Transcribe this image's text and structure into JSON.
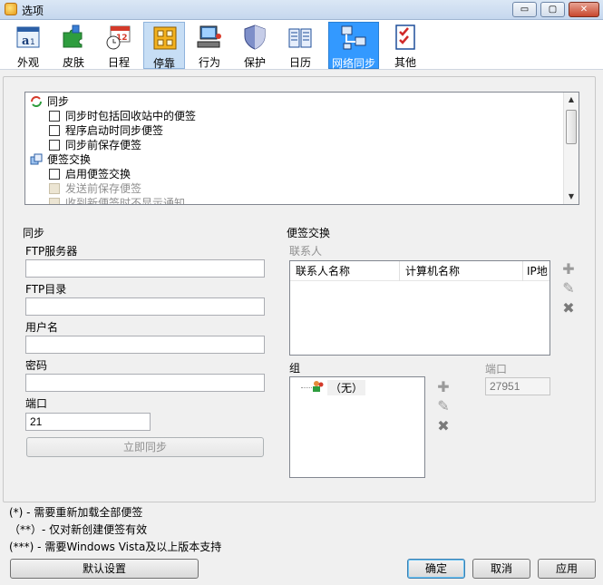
{
  "window": {
    "title": "选项",
    "controls": {
      "minimize": "▭",
      "maximize": "▢",
      "close": "✕"
    }
  },
  "toolbar": {
    "items": [
      {
        "label": "外观",
        "icon": "appearance-icon"
      },
      {
        "label": "皮肤",
        "icon": "skin-puzzle-icon"
      },
      {
        "label": "日程",
        "icon": "schedule-clock-icon"
      },
      {
        "label": "停靠",
        "icon": "dock-grid-icon"
      },
      {
        "label": "行为",
        "icon": "behavior-computer-icon"
      },
      {
        "label": "保护",
        "icon": "shield-icon"
      },
      {
        "label": "日历",
        "icon": "calendar-book-icon"
      },
      {
        "label": "网络同步",
        "icon": "network-sync-icon"
      },
      {
        "label": "其他",
        "icon": "checklist-icon"
      }
    ],
    "selected": "停靠",
    "active": "网络同步"
  },
  "tree": {
    "rows": [
      {
        "type": "group",
        "label": "同步",
        "icon": "sync-group-icon"
      },
      {
        "type": "check",
        "label": "同步时包括回收站中的便签",
        "checked": false,
        "disabled": false
      },
      {
        "type": "check",
        "label": "程序启动时同步便签",
        "checked": false,
        "disabled": false
      },
      {
        "type": "check",
        "label": "同步前保存便签",
        "checked": false,
        "disabled": false
      },
      {
        "type": "group",
        "label": "便签交换",
        "icon": "note-exchange-icon"
      },
      {
        "type": "check",
        "label": "启用便签交换",
        "checked": false,
        "disabled": false
      },
      {
        "type": "check",
        "label": "发送前保存便签",
        "checked": false,
        "disabled": true
      },
      {
        "type": "check",
        "label": "收到新便签时不显示通知",
        "checked": false,
        "disabled": true
      }
    ],
    "scroll": {
      "up": "▲",
      "down": "▼"
    }
  },
  "sync_group": {
    "title": "同步",
    "ftp_server_label": "FTP服务器",
    "ftp_server_value": "",
    "ftp_dir_label": "FTP目录",
    "ftp_dir_value": "",
    "username_label": "用户名",
    "username_value": "",
    "password_label": "密码",
    "password_value": "",
    "port_label": "端口",
    "port_value": "21",
    "sync_now_button": "立即同步"
  },
  "exchange_group": {
    "title": "便签交换",
    "contacts_label": "联系人",
    "columns": [
      "联系人名称",
      "计算机名称",
      "IP地"
    ],
    "group_label": "组",
    "group_tree_item": "（无）",
    "port_label": "端口",
    "port_value": "27951",
    "add_icon": "✚",
    "edit_icon": "✎",
    "delete_icon": "✖"
  },
  "footnotes": [
    "(*) - 需要重新加载全部便签",
    "（**）- 仅对新创建便签有效",
    "(***) - 需要Windows Vista及以上版本支持"
  ],
  "buttons": {
    "defaults": "默认设置",
    "ok": "确定",
    "cancel": "取消",
    "apply": "应用"
  }
}
